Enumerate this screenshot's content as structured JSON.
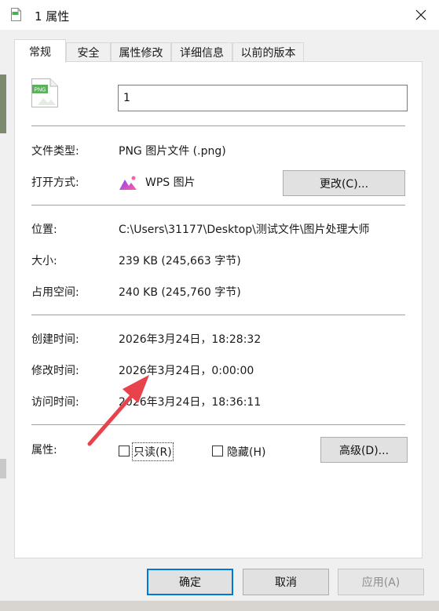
{
  "window": {
    "title": "1 属性"
  },
  "tabs": [
    {
      "label": "常规",
      "active": true
    },
    {
      "label": "安全"
    },
    {
      "label": "属性修改"
    },
    {
      "label": "详细信息"
    },
    {
      "label": "以前的版本"
    }
  ],
  "general": {
    "file_icon_text": "PNG",
    "filename": "1",
    "file_type_label": "文件类型:",
    "file_type_value": "PNG 图片文件 (.png)",
    "open_with_label": "打开方式:",
    "open_with_value": "WPS 图片",
    "change_button": "更改(C)...",
    "location_label": "位置:",
    "location_value": "C:\\Users\\31177\\Desktop\\测试文件\\图片处理大师",
    "size_label": "大小:",
    "size_value": "239 KB (245,663 字节)",
    "size_on_disk_label": "占用空间:",
    "size_on_disk_value": "240 KB (245,760 字节)",
    "created_label": "创建时间:",
    "created_value": "2026年3月24日，18:28:32",
    "modified_label": "修改时间:",
    "modified_value": "2026年3月24日，0:00:00",
    "accessed_label": "访问时间:",
    "accessed_value": "2026年3月24日，18:36:11",
    "attributes_label": "属性:",
    "readonly_label": "只读(R)",
    "readonly_checked": false,
    "hidden_label": "隐藏(H)",
    "hidden_checked": false,
    "advanced_button": "高级(D)..."
  },
  "footer": {
    "ok_label": "确定",
    "cancel_label": "取消",
    "apply_label": "应用(A)"
  },
  "colors": {
    "accent": "#0078d7",
    "annotation_arrow": "#e8434c",
    "wps_gradient_start": "#8a3ffc",
    "wps_gradient_end": "#ff5fa2"
  }
}
